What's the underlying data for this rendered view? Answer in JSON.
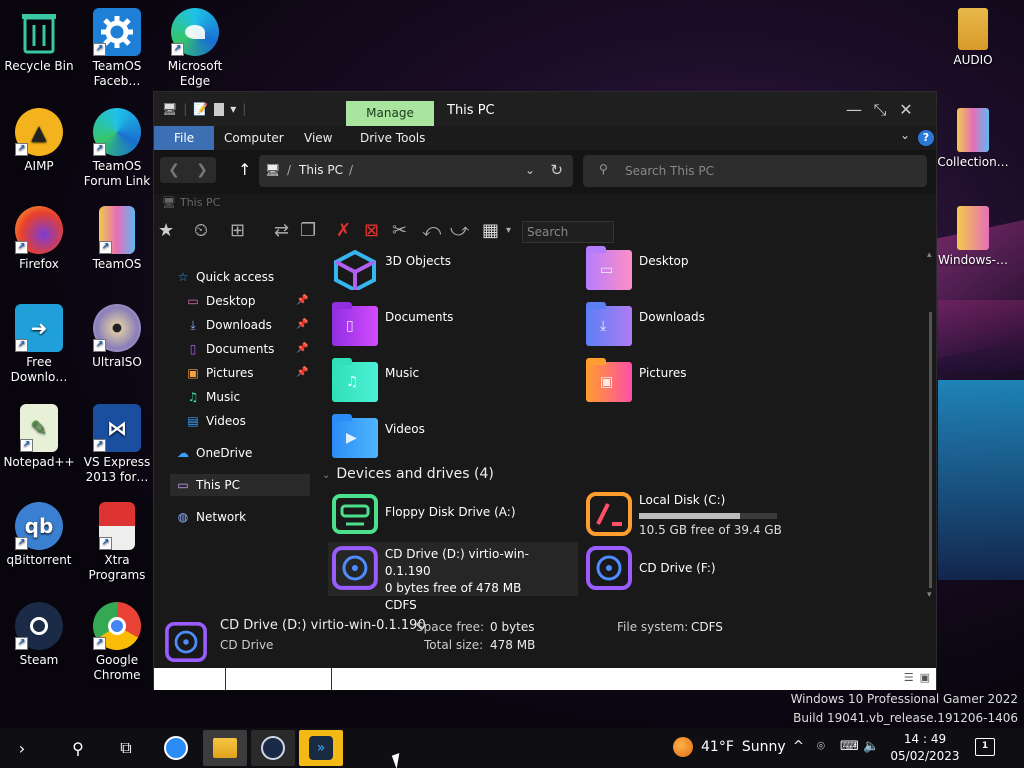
{
  "desktop": {
    "icons": [
      {
        "label": "Recycle Bin",
        "icon": "recycle-bin-icon",
        "shortcut": false
      },
      {
        "label": "TeamOS Faceb…",
        "icon": "gear-icon",
        "shortcut": true
      },
      {
        "label": "Microsoft Edge",
        "icon": "edge-icon",
        "shortcut": true
      },
      {
        "label": "AIMP",
        "icon": "aimp-icon",
        "shortcut": true
      },
      {
        "label": "TeamOS Forum Link",
        "icon": "edge-icon",
        "shortcut": true
      },
      {
        "label": "Firefox",
        "icon": "firefox-icon",
        "shortcut": true
      },
      {
        "label": "TeamOS",
        "icon": "folder-icon",
        "shortcut": true
      },
      {
        "label": "Free Downlo…",
        "icon": "download-manager-icon",
        "shortcut": true
      },
      {
        "label": "UltraISO",
        "icon": "disc-icon",
        "shortcut": true
      },
      {
        "label": "Notepad++",
        "icon": "notepad-icon",
        "shortcut": true
      },
      {
        "label": "VS Express 2013 for…",
        "icon": "visual-studio-icon",
        "shortcut": true
      },
      {
        "label": "qBittorrent",
        "icon": "qbittorrent-icon",
        "shortcut": true
      },
      {
        "label": "Xtra Programs",
        "icon": "toolbox-icon",
        "shortcut": true
      },
      {
        "label": "Steam",
        "icon": "steam-icon",
        "shortcut": true
      },
      {
        "label": "Google Chrome",
        "icon": "chrome-icon",
        "shortcut": true
      },
      {
        "label": "AUDIO",
        "icon": "folder-icon",
        "shortcut": false
      },
      {
        "label": "Collection…",
        "icon": "folder-icon",
        "shortcut": false
      },
      {
        "label": "Windows-…",
        "icon": "folder-icon",
        "shortcut": false
      }
    ]
  },
  "explorer": {
    "manage_tab": "Manage",
    "title": "This PC",
    "menu": {
      "file": "File",
      "computer": "Computer",
      "view": "View",
      "drive_tools": "Drive Tools"
    },
    "help_glyph": "?",
    "address": {
      "path": "This PC"
    },
    "search": {
      "placeholder": "Search This PC"
    },
    "breadcrumb_small": "This PC",
    "iconbar_search": "Search",
    "nav": {
      "quick_access": "Quick access",
      "desktop": "Desktop",
      "downloads": "Downloads",
      "documents": "Documents",
      "pictures": "Pictures",
      "music": "Music",
      "videos": "Videos",
      "onedrive": "OneDrive",
      "this_pc": "This PC",
      "network": "Network"
    },
    "folders": {
      "objects3d": "3D Objects",
      "desktop": "Desktop",
      "documents": "Documents",
      "downloads": "Downloads",
      "music": "Music",
      "pictures": "Pictures",
      "videos": "Videos"
    },
    "devices_header": "Devices and drives (4)",
    "drives": {
      "floppy": {
        "name": "Floppy Disk Drive (A:)"
      },
      "local_c": {
        "name": "Local Disk (C:)",
        "free": "10.5 GB free of 39.4 GB",
        "used_fraction": 0.73
      },
      "cd_d": {
        "name": "CD Drive (D:) virtio-win-0.1.190",
        "free": "0 bytes free of 478 MB",
        "fs": "CDFS"
      },
      "cd_f": {
        "name": "CD Drive (F:)"
      }
    },
    "details": {
      "name": "CD Drive (D:) virtio-win-0.1.190",
      "type": "CD Drive",
      "space_free_label": "Space free:",
      "space_free": "0 bytes",
      "total_size_label": "Total size:",
      "total_size": "478 MB",
      "fs_label": "File system:",
      "fs": "CDFS"
    }
  },
  "watermark": {
    "line1": "Windows 10 Professional Gamer 2022",
    "line2": "Build 19041.vb_release.191206-1406"
  },
  "taskbar": {
    "weather_temp": "41°F",
    "weather_cond": "Sunny",
    "time": "14 : 49",
    "date": "05/02/2023",
    "notifications": "1"
  }
}
